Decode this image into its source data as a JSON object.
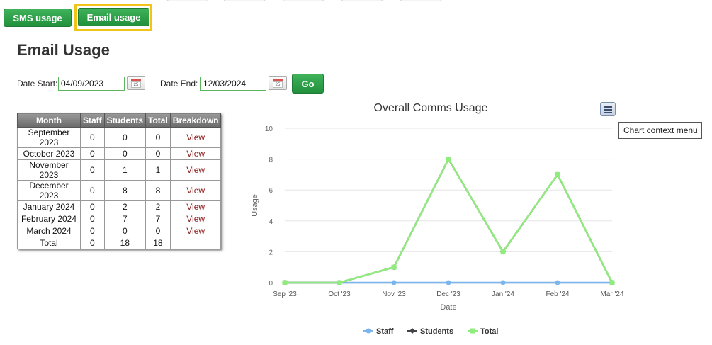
{
  "tabs": {
    "sms_label": "SMS usage",
    "email_label": "Email usage"
  },
  "page": {
    "title": "Email Usage"
  },
  "filters": {
    "date_start_label": "Date Start:",
    "date_start_value": "04/09/2023",
    "date_end_label": "Date End:",
    "date_end_value": "12/03/2024",
    "go_label": "Go",
    "calendar_day": "25"
  },
  "table": {
    "headers": [
      "Month",
      "Staff",
      "Students",
      "Total",
      "Breakdown"
    ],
    "rows": [
      [
        "September 2023",
        "0",
        "0",
        "0",
        "View"
      ],
      [
        "October 2023",
        "0",
        "0",
        "0",
        "View"
      ],
      [
        "November 2023",
        "0",
        "1",
        "1",
        "View"
      ],
      [
        "December 2023",
        "0",
        "8",
        "8",
        "View"
      ],
      [
        "January 2024",
        "0",
        "2",
        "2",
        "View"
      ],
      [
        "February 2024",
        "0",
        "7",
        "7",
        "View"
      ],
      [
        "March 2024",
        "0",
        "0",
        "0",
        "View"
      ]
    ],
    "total_row": [
      "Total",
      "0",
      "18",
      "18",
      ""
    ]
  },
  "chart_menu": {
    "tooltip": "Chart context menu",
    "icon": "hamburger-menu-icon"
  },
  "chart_data": {
    "type": "line",
    "title": "Overall Comms Usage",
    "xlabel": "Date",
    "ylabel": "Usage",
    "categories": [
      "Sep '23",
      "Oct '23",
      "Nov '23",
      "Dec '23",
      "Jan '24",
      "Feb '24",
      "Mar '24"
    ],
    "ylim": [
      0,
      10
    ],
    "yticks": [
      0,
      2,
      4,
      6,
      8,
      10
    ],
    "grid": true,
    "legend": "bottom-center",
    "series": [
      {
        "name": "Staff",
        "values": [
          0,
          0,
          0,
          0,
          0,
          0,
          0
        ],
        "color": "#7cb5ec",
        "marker": "circle"
      },
      {
        "name": "Students",
        "values": [
          0,
          0,
          1,
          8,
          2,
          7,
          0
        ],
        "color": "#434348",
        "marker": "diamond"
      },
      {
        "name": "Total",
        "values": [
          0,
          0,
          1,
          8,
          2,
          7,
          0
        ],
        "color": "#90ed7d",
        "marker": "square"
      }
    ]
  }
}
